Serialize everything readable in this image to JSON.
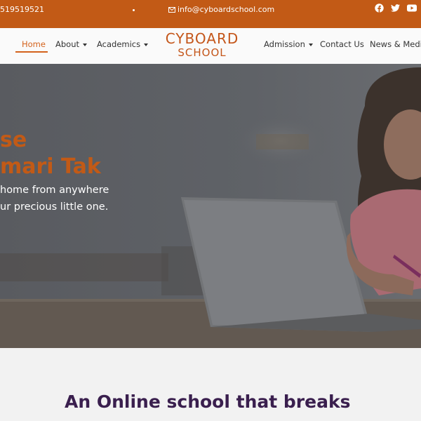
{
  "topbar": {
    "phone": "519519521",
    "email": "info@cyboardschool.com",
    "icons": [
      "facebook-icon",
      "twitter-icon",
      "youtube-icon"
    ]
  },
  "nav": {
    "items": [
      {
        "label": "Home",
        "active": true
      },
      {
        "label": "About",
        "dropdown": true
      },
      {
        "label": "Academics",
        "dropdown": true
      },
      {
        "label": "Admission",
        "dropdown": true
      },
      {
        "label": "Contact Us"
      },
      {
        "label": "News & Media"
      }
    ],
    "logo_line1": "CYBOARD",
    "logo_line2": "SCHOOL"
  },
  "hero": {
    "heading_line1": "se",
    "heading_line2": "mari Tak",
    "text_line1": "home from anywhere",
    "text_line2": "ur precious little one."
  },
  "section": {
    "heading": "An Online school that breaks"
  },
  "colors": {
    "brand_orange": "#c25a16",
    "heading_purple": "#3a1f4e"
  }
}
